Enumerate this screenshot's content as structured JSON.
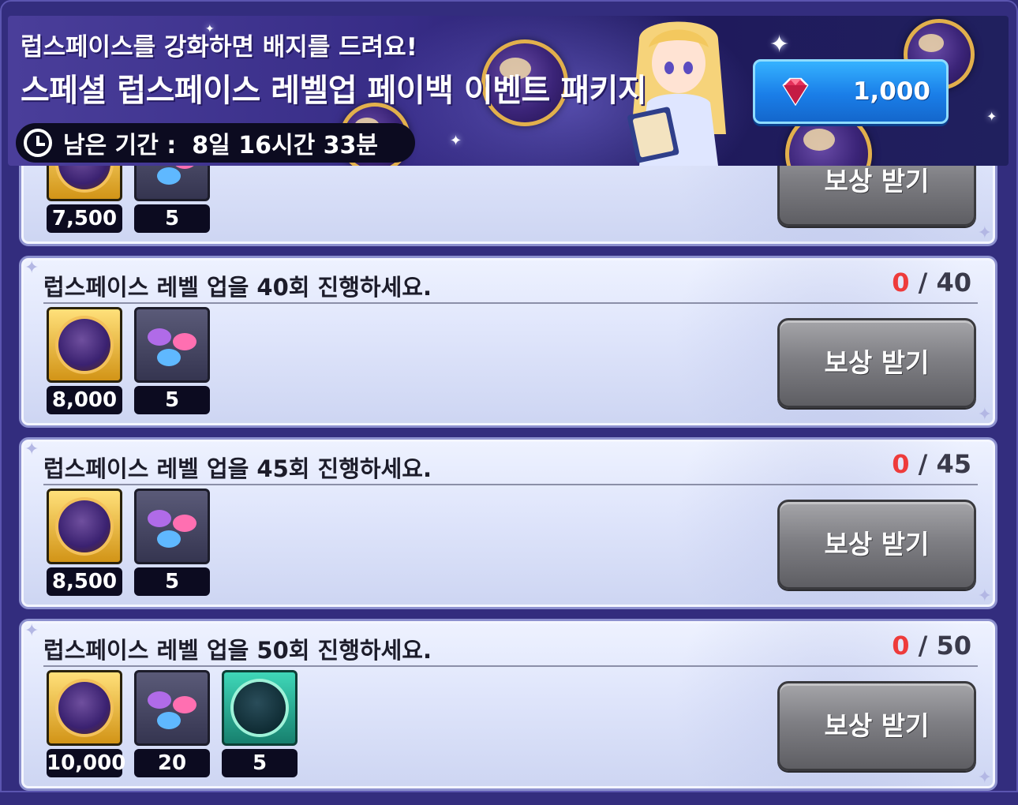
{
  "banner": {
    "subtitle": "럽스페이스를 강화하면 배지를 드려요!",
    "title": "스페셜 럽스페이스 레벨업 페이백 이벤트 패키지",
    "timer_label": "남은 기간 :",
    "timer_value": "8일 16시간 33분",
    "price": "1,000",
    "price_icon": "ruby-gem-icon"
  },
  "colors": {
    "progress_current": "#ee3b3b",
    "buy_button": "#1a7ee8",
    "claim_button": "#7f7f84"
  },
  "missions": [
    {
      "title": "",
      "progress_current": "",
      "progress_sep": "",
      "progress_max": "",
      "rewards": [
        {
          "icon": "lovespace-orb-icon",
          "count": "7,500"
        },
        {
          "icon": "candy-icon",
          "count": "5"
        }
      ],
      "button": "보상 받기"
    },
    {
      "title": "럽스페이스 레벨 업을 40회 진행하세요.",
      "progress_current": "0",
      "progress_sep": "/",
      "progress_max": "40",
      "rewards": [
        {
          "icon": "lovespace-orb-icon",
          "count": "8,000"
        },
        {
          "icon": "candy-icon",
          "count": "5"
        }
      ],
      "button": "보상 받기"
    },
    {
      "title": "럽스페이스 레벨 업을 45회 진행하세요.",
      "progress_current": "0",
      "progress_sep": "/",
      "progress_max": "45",
      "rewards": [
        {
          "icon": "lovespace-orb-icon",
          "count": "8,500"
        },
        {
          "icon": "candy-icon",
          "count": "5"
        }
      ],
      "button": "보상 받기"
    },
    {
      "title": "럽스페이스 레벨 업을 50회 진행하세요.",
      "progress_current": "0",
      "progress_sep": "/",
      "progress_max": "50",
      "rewards": [
        {
          "icon": "lovespace-orb-icon",
          "count": "10,000"
        },
        {
          "icon": "candy-icon",
          "count": "20"
        },
        {
          "icon": "teal-orb-icon",
          "count": "5"
        }
      ],
      "button": "보상 받기"
    }
  ]
}
